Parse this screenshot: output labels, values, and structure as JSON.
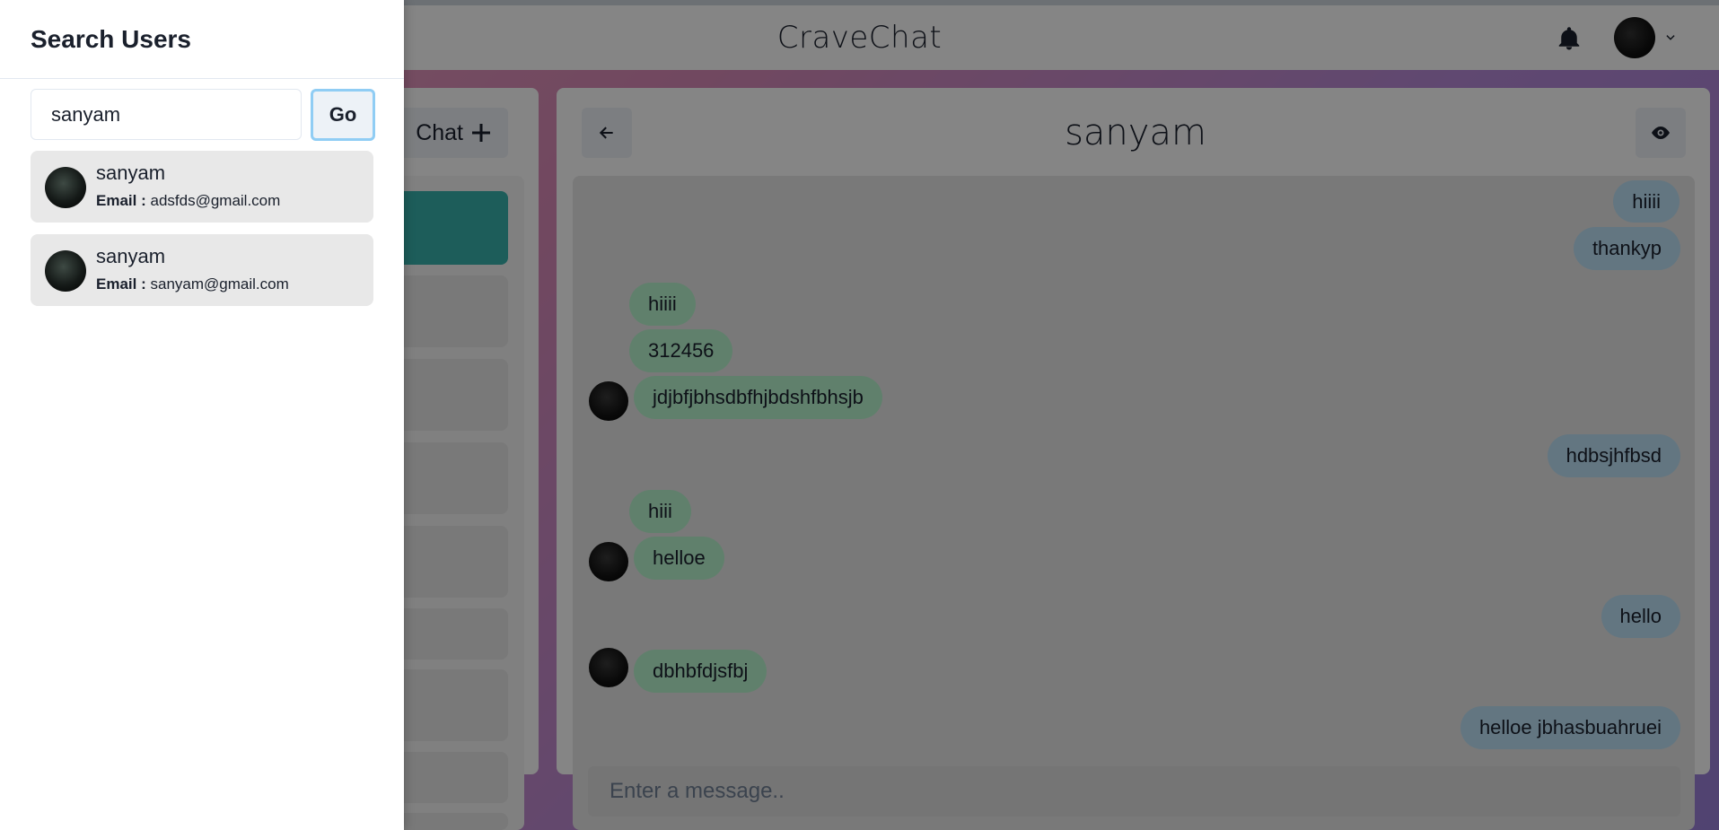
{
  "header": {
    "app_title": "CraveChat",
    "bell_icon": "bell-icon",
    "avatar_icon": "avatar"
  },
  "chats_panel": {
    "new_chat_label": "Chat"
  },
  "chat": {
    "title": "sanyam",
    "input_placeholder": "Enter a message..",
    "messages": [
      {
        "text": "hiiii",
        "type": "sent"
      },
      {
        "text": "thankyp",
        "type": "sent"
      },
      {
        "text": "hiiii",
        "type": "recv"
      },
      {
        "text": "312456",
        "type": "recv"
      },
      {
        "text": "jdjbfjbhsdbfhjbdshfbhsjb",
        "type": "recv"
      },
      {
        "text": "hdbsjhfbsd",
        "type": "sent"
      },
      {
        "text": "hiii",
        "type": "recv"
      },
      {
        "text": "helloe",
        "type": "recv"
      },
      {
        "text": "hello",
        "type": "sent"
      },
      {
        "text": "dbhbfdjsfbj",
        "type": "recv"
      },
      {
        "text": "helloe jbhasbuahruei",
        "type": "sent"
      }
    ]
  },
  "drawer": {
    "title": "Search Users",
    "search_value": "sanyam",
    "go_label": "Go",
    "email_label": "Email :",
    "results": [
      {
        "name": "sanyam",
        "email": "adsfds@gmail.com"
      },
      {
        "name": "sanyam",
        "email": "sanyam@gmail.com"
      }
    ]
  },
  "colors": {
    "accent": "#38b2ac",
    "sent_bubble": "#bee3f8",
    "recv_bubble": "#b9f5d0",
    "focus_ring": "#90cdf4"
  }
}
